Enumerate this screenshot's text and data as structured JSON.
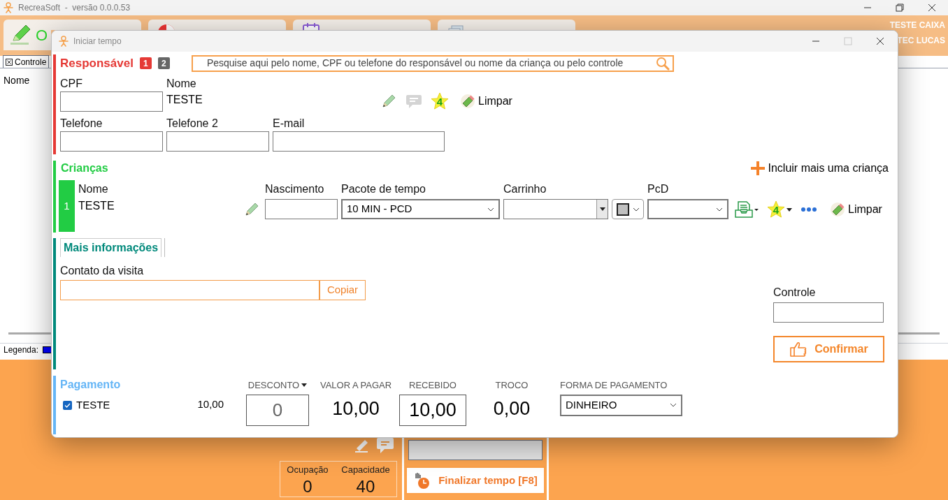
{
  "window": {
    "title": "RecreaSoft  -  versão 0.0.0.53"
  },
  "toolbar": {
    "buttons": [
      {
        "kind": "pencil",
        "label": "O"
      },
      {
        "kind": "chart"
      },
      {
        "kind": "calendar"
      },
      {
        "kind": "document"
      }
    ],
    "user_lines": [
      "TESTE CAIXA",
      "TEC LUCAS"
    ]
  },
  "main": {
    "tab": "Controle",
    "column": "Nome",
    "legend": "Legenda:"
  },
  "stats": [
    {
      "label": "Ocupação",
      "value": "0"
    },
    {
      "label": "Capacidade",
      "value": "40"
    }
  ],
  "finish_button": "Finalizar tempo [F8]",
  "dialog": {
    "title": "Iniciar tempo",
    "responsavel": {
      "heading": "Responsável",
      "steps": [
        {
          "label": "1",
          "selected": true
        },
        {
          "label": "2",
          "selected": false
        }
      ],
      "search_placeholder": "Pesquise aqui pelo nome, CPF ou telefone do responsável ou nome da criança ou pelo controle",
      "cpf_label": "CPF",
      "name_label": "Nome",
      "name": "TESTE",
      "star_count": "4",
      "clear_button": "Limpar",
      "phone_label": "Telefone",
      "phone2_label": "Telefone 2",
      "email_label": "E-mail"
    },
    "criancas": {
      "heading": "Crianças",
      "add_button": "Incluir mais uma criança",
      "entries": [
        {
          "index": "1",
          "name_label": "Nome",
          "name": "TESTE",
          "birth_label": "Nascimento",
          "package_label": "Pacote de tempo",
          "package": "10 MIN - PCD",
          "cart_label": "Carrinho",
          "pcd_label": "PcD",
          "star_count": "4",
          "clear_button": "Limpar"
        }
      ]
    },
    "mais": {
      "tab": "Mais informações",
      "contact_label": "Contato da visita",
      "copy_button": "Copiar",
      "control_label": "Controle",
      "confirm_button": "Confirmar"
    },
    "pagamento": {
      "heading": "Pagamento",
      "items": [
        {
          "name": "TESTE",
          "checked": true,
          "amount": "10,00"
        }
      ],
      "discount_label": "DESCONTO",
      "discount": "0",
      "to_pay_label": "VALOR A PAGAR",
      "to_pay": "10,00",
      "received_label": "RECEBIDO",
      "received": "10,00",
      "change_label": "TROCO",
      "change": "0,00",
      "method_label": "FORMA DE PAGAMENTO",
      "method": "DINHEIRO"
    }
  }
}
